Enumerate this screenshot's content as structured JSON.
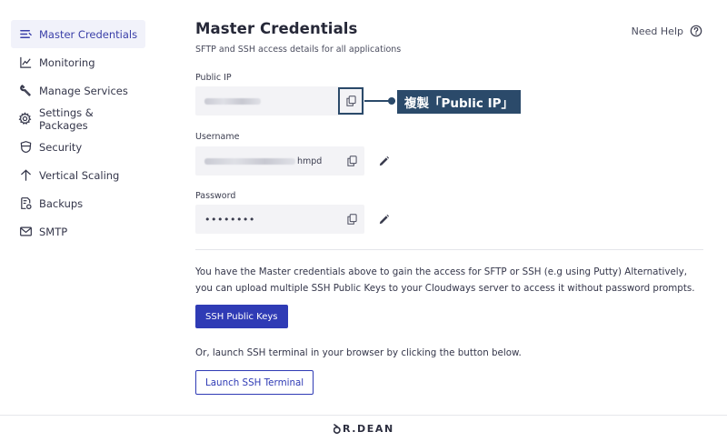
{
  "sidebar": {
    "items": [
      {
        "label": "Master Credentials",
        "icon": "list-icon",
        "active": true
      },
      {
        "label": "Monitoring",
        "icon": "chart-line-icon"
      },
      {
        "label": "Manage Services",
        "icon": "wrench-icon"
      },
      {
        "label": "Settings & Packages",
        "icon": "gear-icon"
      },
      {
        "label": "Security",
        "icon": "shield-icon"
      },
      {
        "label": "Vertical Scaling",
        "icon": "arrow-up-icon"
      },
      {
        "label": "Backups",
        "icon": "backup-file-icon"
      },
      {
        "label": "SMTP",
        "icon": "mail-icon"
      }
    ]
  },
  "header": {
    "title": "Master Credentials",
    "subtitle": "SFTP and SSH access details for all applications",
    "help_label": "Need Help"
  },
  "fields": {
    "public_ip": {
      "label": "Public IP"
    },
    "username": {
      "label": "Username",
      "visible_suffix": "hmpd"
    },
    "password": {
      "label": "Password",
      "masked_value": "••••••••"
    }
  },
  "callout": {
    "text": "複製「Public IP」"
  },
  "info": {
    "text": "You have the Master credentials above to gain the access for SFTP or SSH (e.g using Putty) Alternatively, you can upload multiple SSH Public Keys to your Cloudways server to access it without password prompts.",
    "ssh_keys_button": "SSH Public Keys",
    "terminal_text": "Or, launch SSH terminal in your browser by clicking the button below.",
    "terminal_button": "Launch SSH Terminal"
  },
  "footer": {
    "brand": "R.DEAN"
  },
  "colors": {
    "accent": "#2f3bb5",
    "callout": "#2b4a6a",
    "active_bg": "#f1f2fa"
  }
}
